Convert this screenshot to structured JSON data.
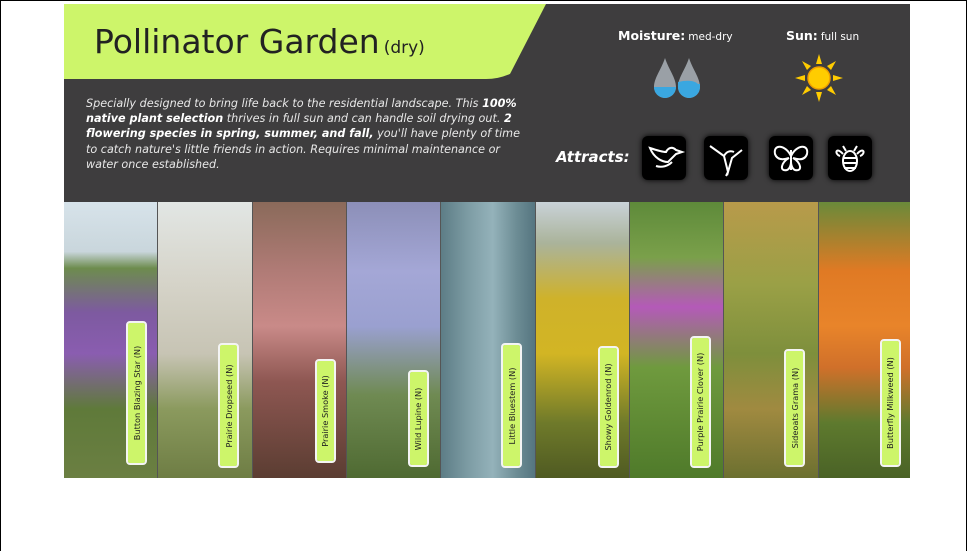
{
  "title": {
    "main": "Pollinator Garden",
    "sub": "(dry)"
  },
  "description": {
    "t1": "Specially designed to bring life back to the residential landscape. This ",
    "b1": "100% native plant selection",
    "t2": " thrives in full sun and can handle soil drying out. ",
    "b2": "2 flowering species in spring, summer, and fall,",
    "t3": " you'll have plenty of time to catch nature's little friends in action. Requires minimal maintenance or water once established."
  },
  "moisture": {
    "label": "Moisture:",
    "value": "med-dry",
    "icon": "water-drops-icon"
  },
  "sun": {
    "label": "Sun:",
    "value": "full sun",
    "icon": "sun-icon"
  },
  "attracts": {
    "label": "Attracts:",
    "icons": [
      "bird-icon",
      "hummingbird-icon",
      "butterfly-icon",
      "bee-icon"
    ]
  },
  "plants": [
    {
      "name": "Button Blazing Star (N)"
    },
    {
      "name": "Prairie Dropseed (N)"
    },
    {
      "name": "Prairie Smoke (N)"
    },
    {
      "name": "Wild Lupine (N)"
    },
    {
      "name": "Little Bluestem (N)"
    },
    {
      "name": "Showy Goldenrod (N)"
    },
    {
      "name": "Purple Prairie Clover (N)"
    },
    {
      "name": "Sideoats Grama (N)"
    },
    {
      "name": "Butterfly Milkweed (N)"
    }
  ],
  "colors": {
    "accent": "#cdf56a",
    "card": "#3e3d3e",
    "drop": "#3aa7e0",
    "sun": "#ffcc00"
  }
}
